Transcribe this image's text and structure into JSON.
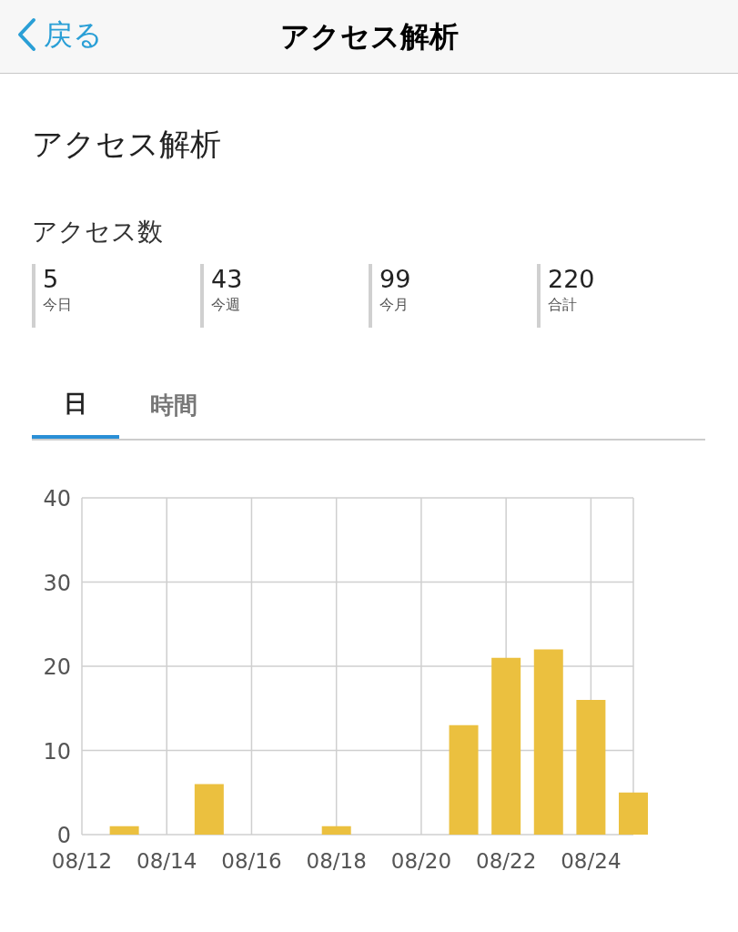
{
  "nav_bar": {
    "back": "戻る",
    "title": "アクセス解析"
  },
  "heading": "アクセス解析",
  "access_count": {
    "title": "アクセス数",
    "stats": [
      {
        "value": "5",
        "label": "今日"
      },
      {
        "value": "43",
        "label": "今週"
      },
      {
        "value": "99",
        "label": "今月"
      },
      {
        "value": "220",
        "label": "合計"
      }
    ]
  },
  "tabs": [
    {
      "label": "日",
      "selected": true
    },
    {
      "label": "時間",
      "selected": false
    }
  ],
  "chart_data": {
    "type": "bar",
    "categories": [
      "08/12",
      null,
      "08/14",
      null,
      "08/16",
      null,
      "08/18",
      null,
      "08/20",
      null,
      "08/22",
      null,
      "08/24",
      null
    ],
    "series": [
      {
        "color": "#ebc03f",
        "values": [
          0,
          1,
          0,
          6,
          0,
          0,
          1,
          0,
          0,
          13,
          21,
          22,
          16,
          5
        ]
      }
    ],
    "grid": true,
    "ylim": [
      0,
      40
    ],
    "yticks": [
      0,
      10,
      20,
      30,
      40
    ]
  }
}
